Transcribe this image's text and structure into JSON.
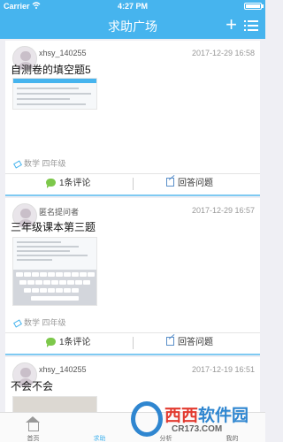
{
  "status": {
    "carrier": "Carrier",
    "time": "4:27 PM"
  },
  "nav": {
    "title": "求助广场",
    "plus": "+"
  },
  "posts": [
    {
      "user": "xhsy_140255",
      "time": "2017-12-29 16:58",
      "title": "自测卷的填空题5",
      "subject": "数学",
      "grade": "四年级",
      "comments": "1条评论",
      "answer": "回答问题"
    },
    {
      "user": "匿名提问者",
      "time": "2017-12-29 16:57",
      "title": "三年级课本第三题",
      "subject": "数学",
      "grade": "四年级",
      "comments": "1条评论",
      "answer": "回答问题"
    },
    {
      "user": "xhsy_140255",
      "time": "2017-12-19 16:51",
      "title": "不会不会"
    }
  ],
  "tabs": [
    {
      "label": "首页",
      "icon": "home-icon"
    },
    {
      "label": "求助",
      "icon": "help-icon",
      "active": true
    },
    {
      "label": "分析",
      "icon": "analysis-icon"
    },
    {
      "label": "我的",
      "icon": "profile-icon"
    }
  ],
  "watermark": {
    "brand_1": "西西",
    "brand_2": "软件园",
    "url": "CR173.COM"
  },
  "colors": {
    "accent": "#46b4ee",
    "comment": "#7dc84b"
  }
}
